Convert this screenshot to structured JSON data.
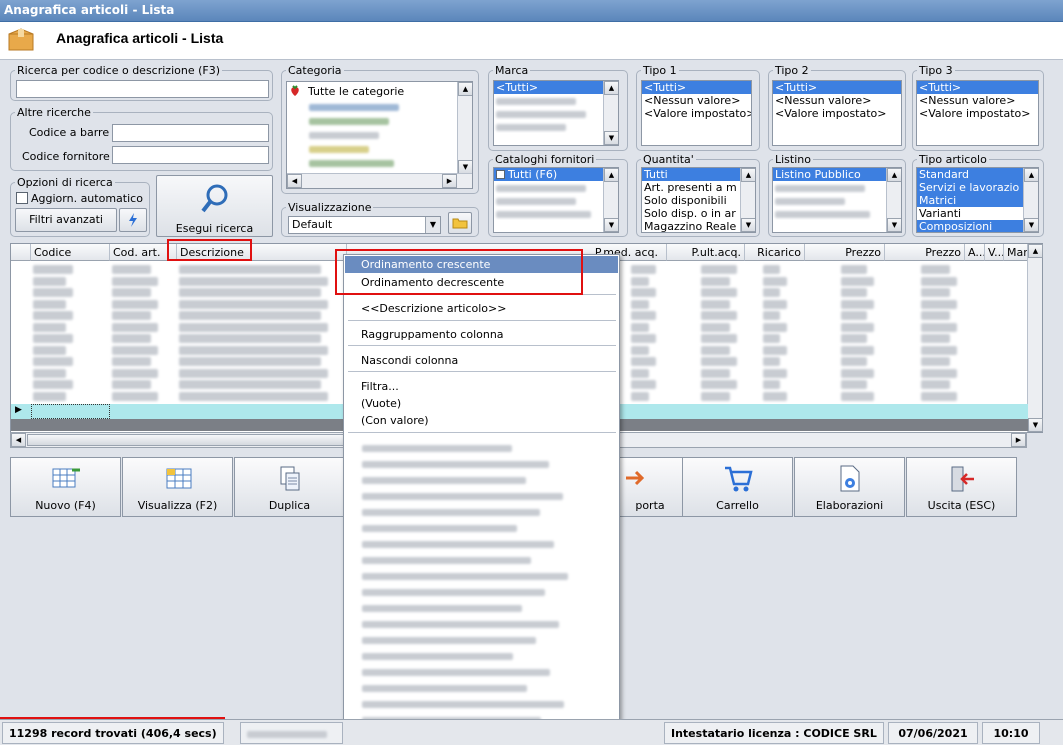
{
  "window": {
    "title": "Anagrafica articoli  - Lista"
  },
  "header": {
    "title": "Anagrafica articoli  - Lista",
    "icon": "box-icon"
  },
  "search": {
    "legend": "Ricerca per codice o descrizione (F3)",
    "value": ""
  },
  "other": {
    "legend": "Altre ricerche",
    "barcode_label": "Codice a barre :",
    "supplier_label": "Codice fornitore :"
  },
  "options": {
    "legend": "Opzioni di ricerca",
    "auto_update": "Aggiorn. automatico",
    "advanced": "Filtri avanzati",
    "run": "Esegui ricerca"
  },
  "categoria": {
    "legend": "Categoria",
    "first": "Tutte le categorie"
  },
  "marca": {
    "legend": "Marca",
    "items": [
      "<Tutti>"
    ]
  },
  "tipo1": {
    "legend": "Tipo 1",
    "items": [
      "<Tutti>",
      "<Nessun valore>",
      "<Valore impostato>"
    ]
  },
  "tipo2": {
    "legend": "Tipo 2",
    "items": [
      "<Tutti>",
      "<Nessun valore>",
      "<Valore impostato>"
    ]
  },
  "tipo3": {
    "legend": "Tipo 3",
    "items": [
      "<Tutti>",
      "<Nessun valore>",
      "<Valore impostato>"
    ]
  },
  "cataloghi": {
    "legend": "Cataloghi fornitori",
    "first": "Tutti (F6)"
  },
  "quantita": {
    "legend": "Quantita'",
    "items": [
      "Tutti",
      "Art. presenti a m",
      "Solo disponibili",
      "Solo disp. o in ar",
      "Magazzino Reale"
    ]
  },
  "listino": {
    "legend": "Listino",
    "first": "Listino Pubblico"
  },
  "tipo_articolo": {
    "legend": "Tipo articolo",
    "items": [
      "Standard",
      "Servizi e lavorazio",
      "Matrici",
      "Varianti",
      "Composizioni"
    ]
  },
  "visualizzazione": {
    "legend": "Visualizzazione",
    "value": "Default"
  },
  "grid": {
    "columns": [
      "Codice",
      "Cod. art.",
      "Descrizione",
      "P.med. acq.",
      "P.ult.acq.",
      "Ricarico",
      "Prezzo",
      "Prezzo",
      "A...",
      "V...",
      "Marc"
    ]
  },
  "context_menu": {
    "sort_asc": "Ordinamento crescente",
    "sort_desc": "Ordinamento decrescente",
    "desc_col": "<<Descrizione articolo>>",
    "group": "Raggruppamento colonna",
    "hide": "Nascondi colonna",
    "filter": "Filtra...",
    "empty": "(Vuote)",
    "with_value": "(Con valore)"
  },
  "toolbar": {
    "new": "Nuovo (F4)",
    "view": "Visualizza (F2)",
    "duplicate": "Duplica",
    "export": "porta",
    "cart": "Carrello",
    "processing": "Elaborazioni",
    "exit": "Uscita (ESC)"
  },
  "status": {
    "records": "11298 record trovati (406,4 secs)",
    "license": "Intestatario licenza : CODICE SRL",
    "date": "07/06/2021",
    "time": "10:10"
  },
  "colors": {
    "selection": "#3d7fe0",
    "highlight": "#e01010",
    "row_current": "#aee8ec"
  }
}
